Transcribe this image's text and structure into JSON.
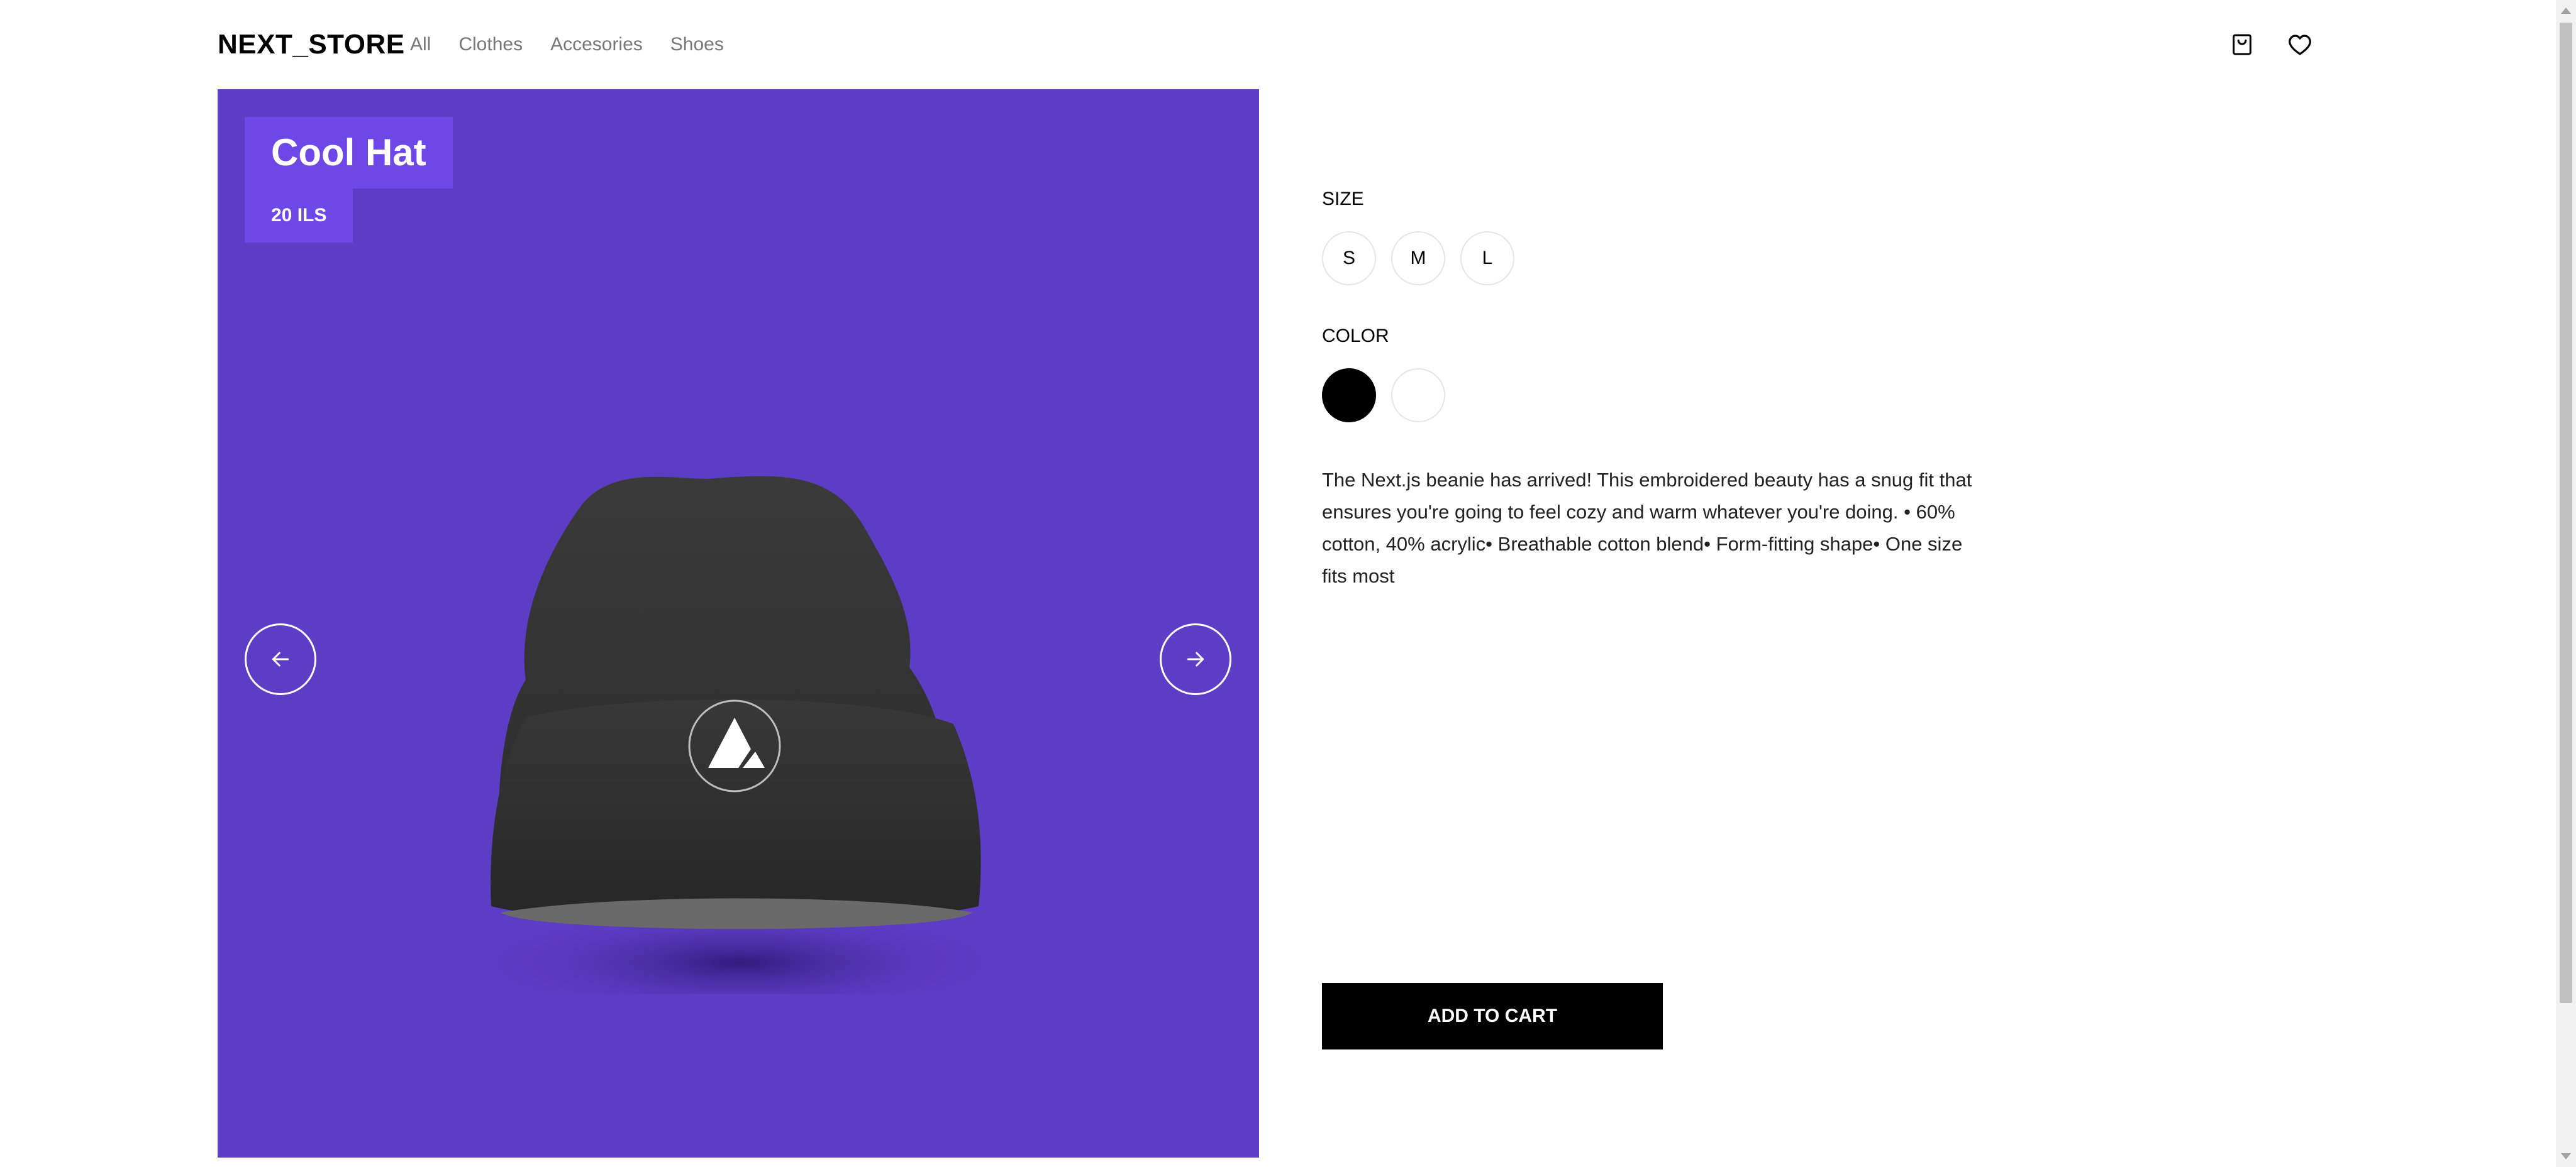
{
  "header": {
    "logo": "NEXT_STORE",
    "nav": [
      {
        "label": "All"
      },
      {
        "label": "Clothes"
      },
      {
        "label": "Accesories"
      },
      {
        "label": "Shoes"
      }
    ],
    "icons": [
      "cart-icon",
      "heart-icon"
    ]
  },
  "product": {
    "title": "Cool Hat",
    "price": "20 ILS",
    "gallery_bg": "#5e3dc6",
    "accent": "#6e47e7",
    "image": "black-beanie-icon",
    "size_label": "SIZE",
    "sizes": [
      "S",
      "M",
      "L"
    ],
    "color_label": "COLOR",
    "colors": [
      "#000000",
      "#ffffff"
    ],
    "description": "The Next.js beanie has arrived! This embroidered beauty has a snug fit that ensures you're going to feel cozy and warm whatever you're doing. • 60% cotton, 40% acrylic• Breathable cotton blend• Form-fitting shape• One size fits most",
    "add_to_cart": "ADD TO CART"
  }
}
